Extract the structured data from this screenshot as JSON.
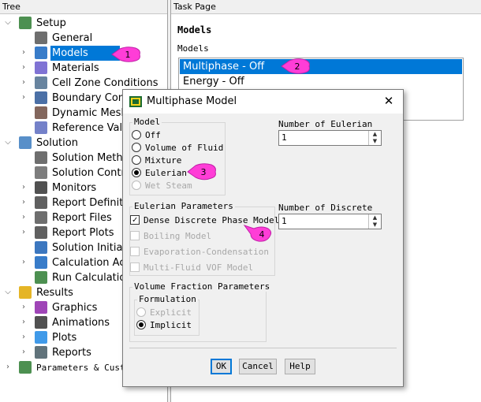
{
  "tree": {
    "header": "Tree",
    "items": [
      {
        "label": "Setup",
        "icon": "setup-icon",
        "expander": "expanded"
      },
      {
        "label": "General",
        "icon": "general-icon",
        "expander": "none"
      },
      {
        "label": "Models",
        "icon": "models-icon",
        "expander": "collapsed",
        "selected": true
      },
      {
        "label": "Materials",
        "icon": "materials-icon",
        "expander": "collapsed"
      },
      {
        "label": "Cell Zone Conditions",
        "icon": "cell-zone-icon",
        "expander": "collapsed"
      },
      {
        "label": "Boundary Conditions",
        "icon": "boundary-icon",
        "expander": "collapsed"
      },
      {
        "label": "Dynamic Mesh",
        "icon": "dynamic-mesh-icon",
        "expander": "none"
      },
      {
        "label": "Reference Values",
        "icon": "reference-values-icon",
        "expander": "none"
      },
      {
        "label": "Solution",
        "icon": "solution-icon",
        "expander": "expanded"
      },
      {
        "label": "Solution Methods",
        "icon": "solution-methods-icon",
        "expander": "none"
      },
      {
        "label": "Solution Controls",
        "icon": "solution-controls-icon",
        "expander": "none"
      },
      {
        "label": "Monitors",
        "icon": "monitors-icon",
        "expander": "collapsed"
      },
      {
        "label": "Report Definitions",
        "icon": "report-definitions-icon",
        "expander": "collapsed"
      },
      {
        "label": "Report Files",
        "icon": "report-files-icon",
        "expander": "collapsed"
      },
      {
        "label": "Report Plots",
        "icon": "report-plots-icon",
        "expander": "collapsed"
      },
      {
        "label": "Solution Initialization",
        "icon": "initialization-icon",
        "expander": "none"
      },
      {
        "label": "Calculation Activities",
        "icon": "calc-activities-icon",
        "expander": "collapsed"
      },
      {
        "label": "Run Calculation",
        "icon": "run-calculation-icon",
        "expander": "none"
      },
      {
        "label": "Results",
        "icon": "results-icon",
        "expander": "expanded"
      },
      {
        "label": "Graphics",
        "icon": "graphics-icon",
        "expander": "collapsed"
      },
      {
        "label": "Animations",
        "icon": "animations-icon",
        "expander": "collapsed"
      },
      {
        "label": "Plots",
        "icon": "plots-icon",
        "expander": "collapsed"
      },
      {
        "label": "Reports",
        "icon": "reports-icon",
        "expander": "collapsed"
      },
      {
        "label": "Parameters & Customization",
        "icon": "parameters-icon",
        "expander": "collapsed"
      }
    ]
  },
  "task_page": {
    "header": "Task Page",
    "title": "Models",
    "list_label": "Models",
    "models": [
      {
        "label": "Multiphase - Off",
        "selected": true
      },
      {
        "label": "Energy - Off",
        "selected": false
      }
    ]
  },
  "dialog": {
    "title": "Multiphase Model",
    "model_group": {
      "label": "Model",
      "options": [
        {
          "label": "Off",
          "checked": false,
          "disabled": false
        },
        {
          "label": "Volume of Fluid",
          "checked": false,
          "disabled": false
        },
        {
          "label": "Mixture",
          "checked": false,
          "disabled": false
        },
        {
          "label": "Eulerian",
          "checked": true,
          "disabled": false
        },
        {
          "label": "Wet Steam",
          "checked": false,
          "disabled": true
        }
      ]
    },
    "eulerian_phases": {
      "label": "Number of Eulerian Phases",
      "value": "1"
    },
    "discrete_phases": {
      "label": "Number of Discrete Phases",
      "value": "1"
    },
    "eulerian_params": {
      "label": "Eulerian Parameters",
      "options": [
        {
          "label": "Dense Discrete Phase Model",
          "checked": true,
          "disabled": false
        },
        {
          "label": "Boiling Model",
          "checked": false,
          "disabled": true
        },
        {
          "label": "Evaporation-Condensation",
          "checked": false,
          "disabled": true
        },
        {
          "label": "Multi-Fluid VOF Model",
          "checked": false,
          "disabled": true
        }
      ]
    },
    "volume_fraction": {
      "label": "Volume Fraction Parameters",
      "formulation_label": "Formulation",
      "options": [
        {
          "label": "Explicit",
          "checked": false,
          "disabled": true
        },
        {
          "label": "Implicit",
          "checked": true,
          "disabled": false
        }
      ]
    },
    "buttons": {
      "ok": "OK",
      "cancel": "Cancel",
      "help": "Help"
    }
  },
  "callouts": [
    "1",
    "2",
    "3",
    "4"
  ],
  "colors": {
    "selection": "#0078d7",
    "callout": "#ff3dd7",
    "default_button_border": "#0078d7"
  }
}
